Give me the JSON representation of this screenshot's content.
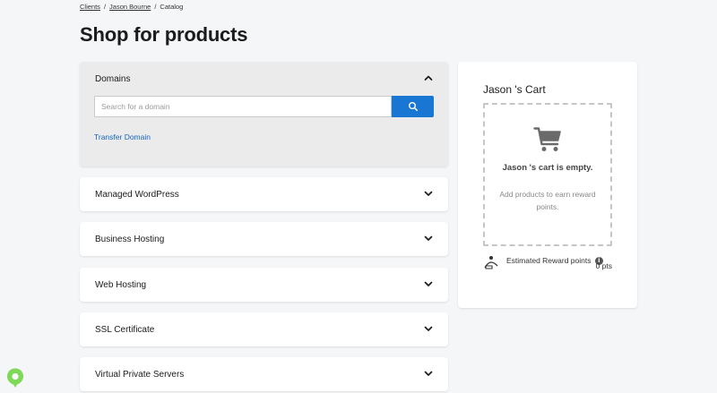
{
  "breadcrumb": {
    "items": [
      {
        "label": "Clients",
        "link": true
      },
      {
        "label": "Jason Bourne",
        "link": true
      },
      {
        "label": "Catalog",
        "link": false
      }
    ],
    "separator": "/"
  },
  "page": {
    "title": "Shop for products"
  },
  "domains": {
    "title": "Domains",
    "search_placeholder": "Search for a domain",
    "search_value": "",
    "transfer_link": "Transfer Domain"
  },
  "products": [
    {
      "label": "Managed WordPress"
    },
    {
      "label": "Business Hosting"
    },
    {
      "label": "Web Hosting"
    },
    {
      "label": "SSL Certificate"
    },
    {
      "label": "Virtual Private Servers"
    }
  ],
  "cart": {
    "title": "Jason 's Cart",
    "empty_message": "Jason 's cart is empty.",
    "empty_sub": "Add products to earn reward points.",
    "reward_label": "Estimated Reward points",
    "reward_points": "0 pts"
  },
  "colors": {
    "accent": "#1976d2",
    "link": "#1565c0",
    "help_badge": "#7ed957"
  },
  "icons": {
    "search": "search-icon",
    "cart": "cart-icon",
    "chevron_up": "chevron-up-icon",
    "chevron_down": "chevron-down-icon",
    "info": "info-icon",
    "reward": "reward-icon",
    "help": "help-badge-icon"
  }
}
